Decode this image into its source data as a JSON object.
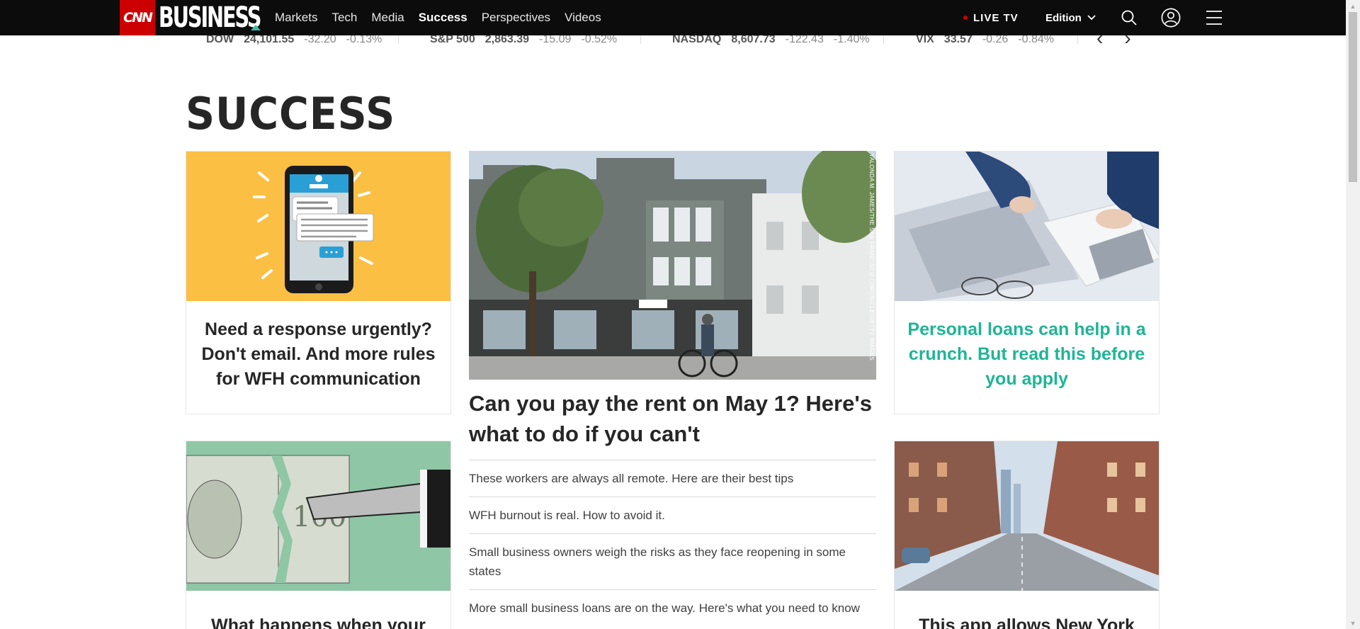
{
  "brand": {
    "cnn": "CNN",
    "business": "BUSINESS"
  },
  "nav": {
    "links": [
      "Markets",
      "Tech",
      "Media",
      "Success",
      "Perspectives",
      "Videos"
    ],
    "active": "Success",
    "live_tv": "LIVE TV",
    "edition": "Edition"
  },
  "ticker": {
    "items": [
      {
        "name": "DOW",
        "value": "24,101.55",
        "change": "-32.20",
        "pct": "-0.13%"
      },
      {
        "name": "S&P 500",
        "value": "2,863.39",
        "change": "-15.09",
        "pct": "-0.52%"
      },
      {
        "name": "NASDAQ",
        "value": "8,607.73",
        "change": "-122.43",
        "pct": "-1.40%"
      },
      {
        "name": "VIX",
        "value": "33.57",
        "change": "-0.26",
        "pct": "-0.84%"
      }
    ],
    "prev": "‹",
    "next": "›"
  },
  "section": {
    "title": "SUCCESS"
  },
  "cards": {
    "top_left": {
      "headline": "Need a response urgently? Don't email. And more rules for WFH communication",
      "image": "phone-messages-illustration"
    },
    "top_right": {
      "headline": "Personal loans can help in a crunch. But read this before you apply",
      "image": "calculator-laptop-photo"
    },
    "bottom_left": {
      "headline": "What happens when your",
      "image": "torn-dollar-bill-illustration"
    },
    "bottom_right": {
      "headline": "This app allows New York",
      "image": "empty-city-street-photo"
    }
  },
  "feature": {
    "headline": "Can you pay the rent on May 1? Here's what to do if you can't",
    "image": "san-francisco-building-cyclist",
    "photo_credit": "YALONDA M. JAMES/THE SAN FRANCISCO CHRONICLE/GETTY IMAGES",
    "related": [
      "These workers are always all remote. Here are their best tips",
      "WFH burnout is real. How to avoid it.",
      "Small business owners weigh the risks as they face reopening in some states",
      "More small business loans are on the way. Here's what you need to know"
    ]
  },
  "colors": {
    "nav_bg": "#0c0c0c",
    "cnn_red": "#cc0000",
    "teal": "#1eb595",
    "card_yellow": "#fbbf44",
    "card_mint": "#8fc6a6"
  }
}
